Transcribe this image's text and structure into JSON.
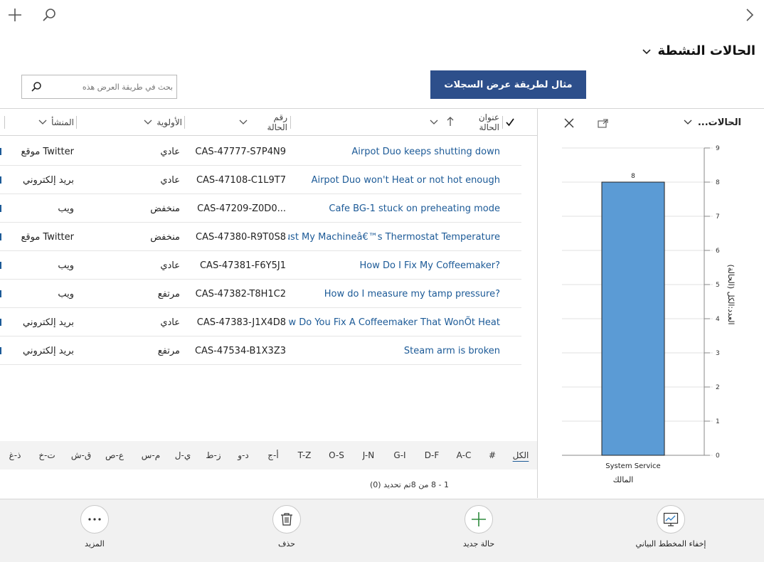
{
  "topbar": {
    "add_icon": "plus-icon",
    "search_icon": "search-icon",
    "back_icon": "chevron-right-icon"
  },
  "view": {
    "title": "الحالات النشطة"
  },
  "search": {
    "placeholder": "بحث في طريقة العرض هذه"
  },
  "callout": {
    "text": "مثال لطريقة عرض السجلات"
  },
  "grid": {
    "headers": {
      "case_title": "عنوان الحالة",
      "case_number": "رقم الحالة",
      "priority": "الأولوية",
      "origin": "المنشأ"
    },
    "rows": [
      {
        "title": "Airpot Duo keeps shutting down",
        "case_number": "CAS-47777-S7P4N9",
        "priority": "عادي",
        "origin": "موقع Twitter"
      },
      {
        "title": "Airpot Duo won't Heat or not hot enough",
        "case_number": "CAS-47108-C1L9T7",
        "priority": "عادي",
        "origin": "بريد إلكتروني"
      },
      {
        "title": "Cafe BG-1 stuck on preheating mode",
        "case_number": "CAS-47209-Z0D0...",
        "priority": "منخفض",
        "origin": "ويب"
      },
      {
        "title": "ljust My Machineâ€™s Thermostat Temperature",
        "case_number": "CAS-47380-R9T0S8",
        "priority": "منخفض",
        "origin": "موقع Twitter"
      },
      {
        "title": "How Do I Fix My Coffeemaker?",
        "case_number": "CAS-47381-F6Y5J1",
        "priority": "عادي",
        "origin": "ويب"
      },
      {
        "title": "How do I measure my tamp pressure?",
        "case_number": "CAS-47382-T8H1C2",
        "priority": "مرتفع",
        "origin": "ويب"
      },
      {
        "title": "ow Do You Fix A Coffeemaker That WonÕt Heat",
        "case_number": "CAS-47383-J1X4D8",
        "priority": "عادي",
        "origin": "بريد إلكتروني"
      },
      {
        "title": "Steam arm is broken",
        "case_number": "CAS-47534-B1X3Z3",
        "priority": "مرتفع",
        "origin": "بريد إلكتروني"
      }
    ]
  },
  "alphabet": [
    "الكل",
    "#",
    "A-C",
    "D-F",
    "G-I",
    "J-N",
    "O-S",
    "T-Z",
    "أ-ج",
    "د-و",
    "ز-ط",
    "ي-ل",
    "م-س",
    "ع-ص",
    "ق-ش",
    "ت-خ",
    "ذ-غ"
  ],
  "status": {
    "text": "1 - 8 من 8تم تحديد (0)"
  },
  "chart_panel": {
    "title": "الحالات...",
    "expand_icon": "popout-icon",
    "close_icon": "close-icon"
  },
  "chart_data": {
    "type": "bar",
    "categories": [
      "System Service"
    ],
    "values": [
      8
    ],
    "data_labels": [
      "8"
    ],
    "xlabel": "المالك",
    "ylabel": "العدد:الكل (الحالة)",
    "ylim": [
      0,
      9
    ],
    "yticks": [
      0,
      1,
      2,
      3,
      4,
      5,
      6,
      7,
      8,
      9
    ],
    "grid": true,
    "bar_color": "#5b9bd5"
  },
  "commands": [
    {
      "label": "إخفاء المخطط البياني",
      "icon": "chart-icon"
    },
    {
      "label": "حالة جديد",
      "icon": "plus-icon"
    },
    {
      "label": "حذف",
      "icon": "trash-icon"
    },
    {
      "label": "المزيد",
      "icon": "more-icon"
    }
  ],
  "colors": {
    "accent": "#1c5a97",
    "callout": "#2d4f8b",
    "new_green": "#2e8b3d"
  }
}
